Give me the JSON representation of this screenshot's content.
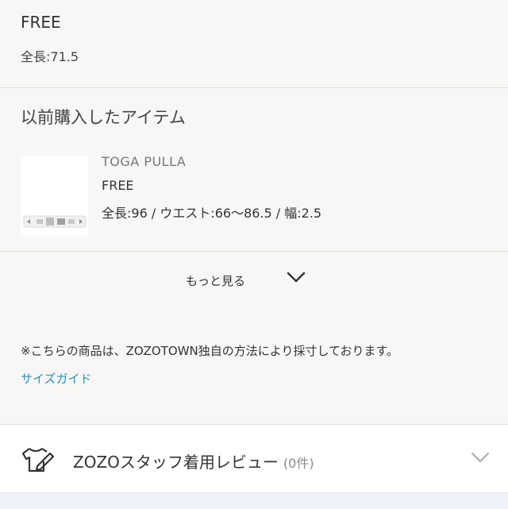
{
  "current_size": {
    "label": "FREE",
    "detail": "全長:71.5"
  },
  "previous_purchase": {
    "title": "以前購入したアイテム",
    "item": {
      "brand": "TOGA PULLA",
      "size": "FREE",
      "detail": "全長:96 / ウエスト:66〜86.5 / 幅:2.5"
    }
  },
  "more": {
    "label": "もっと見る",
    "icon": "chevron-down-icon"
  },
  "note": "※こちらの商品は、ZOZOTOWN独自の方法により採寸しております。",
  "size_guide_link": "サイズガイド",
  "review": {
    "label": "ZOZOスタッフ着用レビュー",
    "count": "(0件)",
    "icon": "tshirt-pen-icon",
    "chevron": "chevron-down-icon"
  },
  "colors": {
    "link": "#2a8fc4",
    "background": "#f8f7f5"
  }
}
